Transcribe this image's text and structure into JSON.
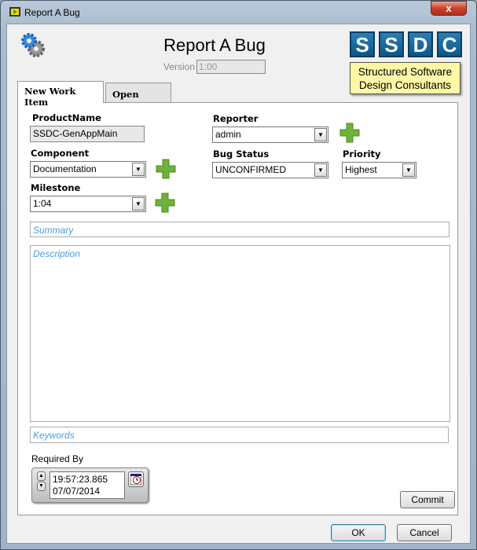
{
  "window": {
    "title": "Report A Bug",
    "close": "x"
  },
  "header": {
    "title": "Report A Bug",
    "version_label": "Version",
    "version_value": "1:00"
  },
  "logo": {
    "letters": [
      "S",
      "S",
      "D",
      "C"
    ],
    "line1": "Structured Software",
    "line2": "Design Consultants"
  },
  "tabs": [
    {
      "label": "New Work Item",
      "active": true
    },
    {
      "label": "Open Items",
      "active": false
    }
  ],
  "form": {
    "product_label": "ProductName",
    "product_value": "SSDC-GenAppMain",
    "component_label": "Component",
    "component_value": "Documentation",
    "milestone_label": "Milestone",
    "milestone_value": "1:04",
    "reporter_label": "Reporter",
    "reporter_value": "admin",
    "status_label": "Bug Status",
    "status_value": "UNCONFIRMED",
    "priority_label": "Priority",
    "priority_value": "Highest",
    "summary_placeholder": "Summary",
    "description_placeholder": "Description",
    "keywords_placeholder": "Keywords",
    "required_label": "Required By",
    "required_time": "19:57:23.865",
    "required_date": "07/07/2014",
    "commit": "Commit"
  },
  "buttons": {
    "ok": "OK",
    "cancel": "Cancel"
  },
  "colors": {
    "plus": "#6fb23a",
    "placeholder": "#4a9ee0",
    "logo_blue": "#0e5686",
    "logo_yellow": "#fdf7a6"
  }
}
